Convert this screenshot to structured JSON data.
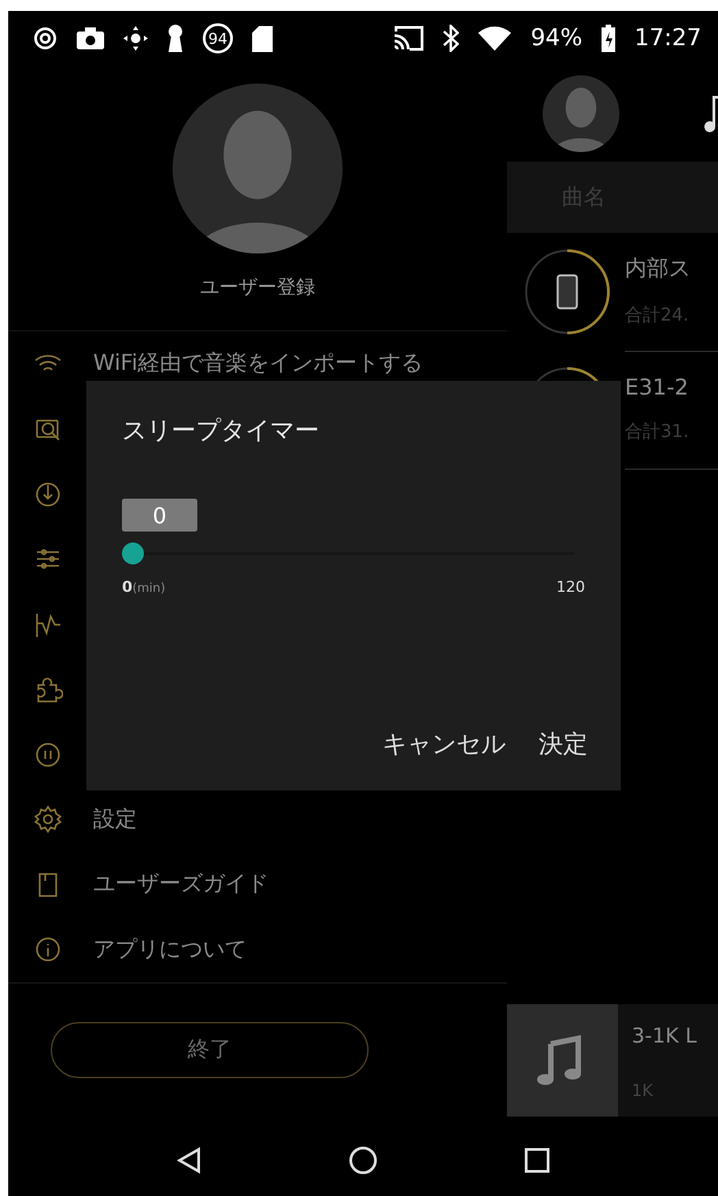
{
  "status_bar": {
    "badge": "94",
    "battery": "94%",
    "time": "17:27"
  },
  "drawer": {
    "user_label": "ユーザー登録",
    "top_items": [
      {
        "label": "WiFi経由で音楽をインポートする"
      }
    ],
    "bottom_items": [
      {
        "label": "設定"
      },
      {
        "label": "ユーザーズガイド"
      },
      {
        "label": "アプリについて"
      }
    ],
    "exit_button": "終了"
  },
  "library": {
    "tabs": [
      {
        "label": "曲名",
        "selected": false
      }
    ],
    "storages": [
      {
        "name": "内部ス",
        "total": "合計24."
      },
      {
        "name": "E31-2",
        "total": "合計31."
      }
    ],
    "mini_player": {
      "title": "3-1K L",
      "subtitle": "1K"
    }
  },
  "dialog": {
    "title": "スリープタイマー",
    "slider": {
      "bubble": "0",
      "level": 0,
      "min": "0",
      "unit": "(min)",
      "max": "120"
    },
    "buttons": [
      "キャンセル",
      "決定"
    ]
  }
}
